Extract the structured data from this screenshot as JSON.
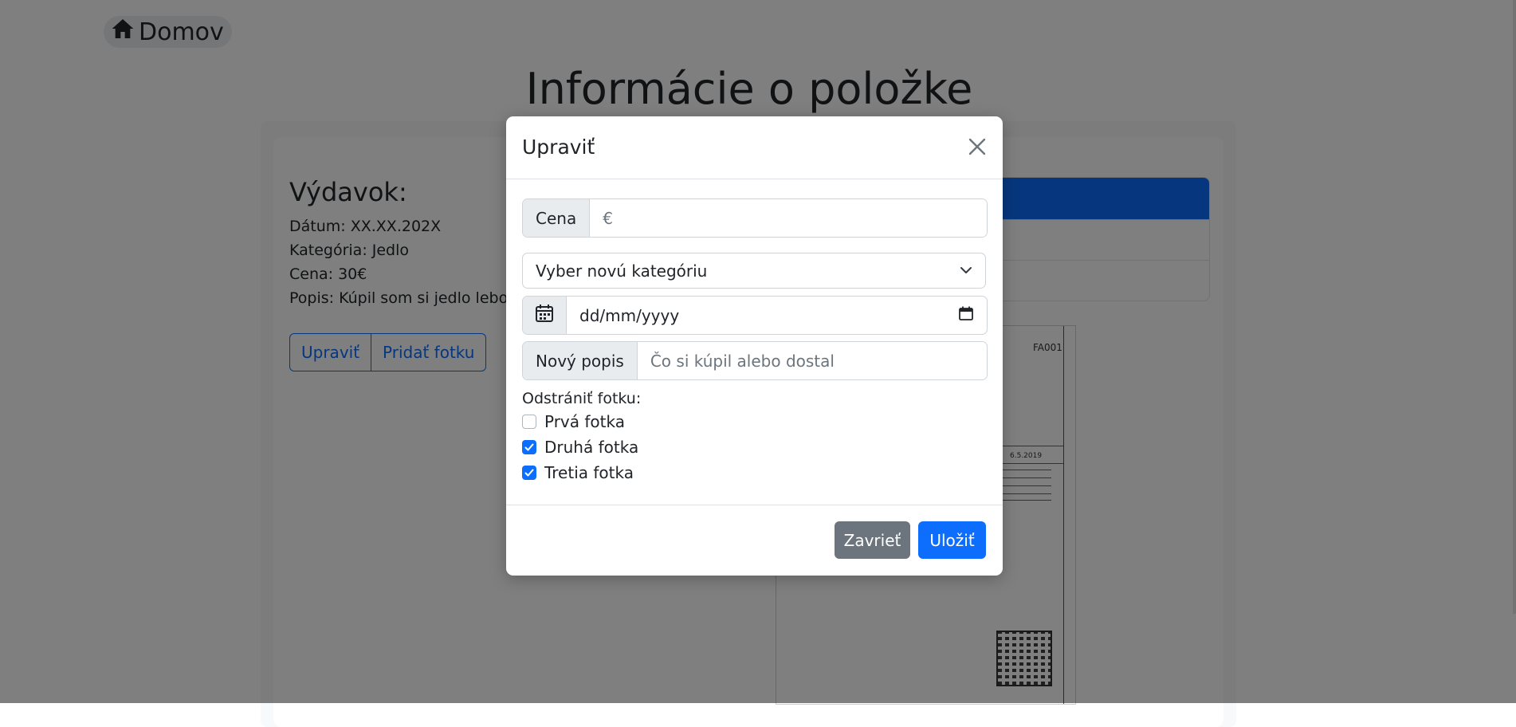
{
  "nav": {
    "home_label": "Domov"
  },
  "page": {
    "title": "Informácie o položke",
    "expense_heading": "Výdavok:",
    "details": [
      "Dátum: XX.XX.202X",
      "Kategória: Jedlo",
      "Cena: 30€",
      "Popis: Kúpil som si jedlo lebo som"
    ],
    "actions": {
      "edit_label": "Upraviť",
      "add_photo_label": "Pridať fotku"
    },
    "invoice": {
      "number": "FA001",
      "date": "6.5.2019"
    }
  },
  "modal": {
    "title": "Upraviť",
    "price": {
      "addon": "Cena",
      "placeholder": "€",
      "value": ""
    },
    "category": {
      "selected": "Vyber novú kategóriu"
    },
    "date": {
      "placeholder": "dd/mm/yyyy"
    },
    "description": {
      "addon": "Nový popis",
      "placeholder": "Čo si kúpil alebo dostal",
      "value": ""
    },
    "remove_photo": {
      "label": "Odstrániť fotku:",
      "options": [
        {
          "label": "Prvá fotka",
          "checked": false
        },
        {
          "label": "Druhá fotka",
          "checked": true
        },
        {
          "label": "Tretia fotka",
          "checked": true
        }
      ]
    },
    "footer": {
      "close_label": "Zavrieť",
      "save_label": "Uložiť"
    }
  },
  "colors": {
    "primary": "#0d6efd",
    "secondary": "#6c757d",
    "backdrop": "rgba(0,0,0,0.5)"
  }
}
